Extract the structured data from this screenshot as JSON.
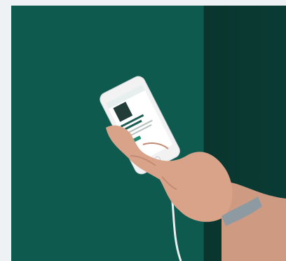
{
  "scene": {
    "subject": "hand-holding-smartphone",
    "colors": {
      "wall": "#0f5a4f",
      "wall_shadow": "#0b3e37",
      "page_bg": "#eef2f5",
      "skin": "#d9a38a",
      "phone": "#f2f2f2",
      "band": "#8e9aa1"
    }
  },
  "phone_screen": {
    "brand": "",
    "headline": "",
    "button": ""
  }
}
